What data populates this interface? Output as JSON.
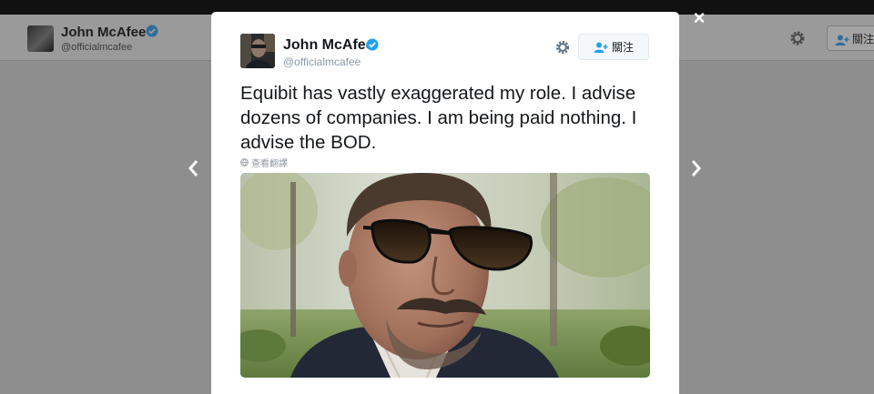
{
  "background_profile": {
    "name": "John McAfee",
    "handle": "@officialmcafee",
    "follow_label": "關注"
  },
  "tweet": {
    "author_name": "John McAfee",
    "author_handle": "@officialmcafee",
    "follow_label": "關注",
    "text": "Equibit has vastly exaggerated my role. I advise dozens of companies. I am being paid nothing. I advise the BOD.",
    "translate_label": "查看翻譯"
  },
  "icons": {
    "close": "close-icon",
    "previous": "chevron-left-icon",
    "next": "chevron-right-icon",
    "settings": "gear-icon",
    "verified": "verified-badge-icon",
    "follow": "add-user-icon",
    "globe": "globe-icon"
  },
  "colors": {
    "verified": "#1da1f2",
    "follow_icon": "#1da1f2",
    "text": "#14171a",
    "secondary_text": "#8b98a5"
  }
}
